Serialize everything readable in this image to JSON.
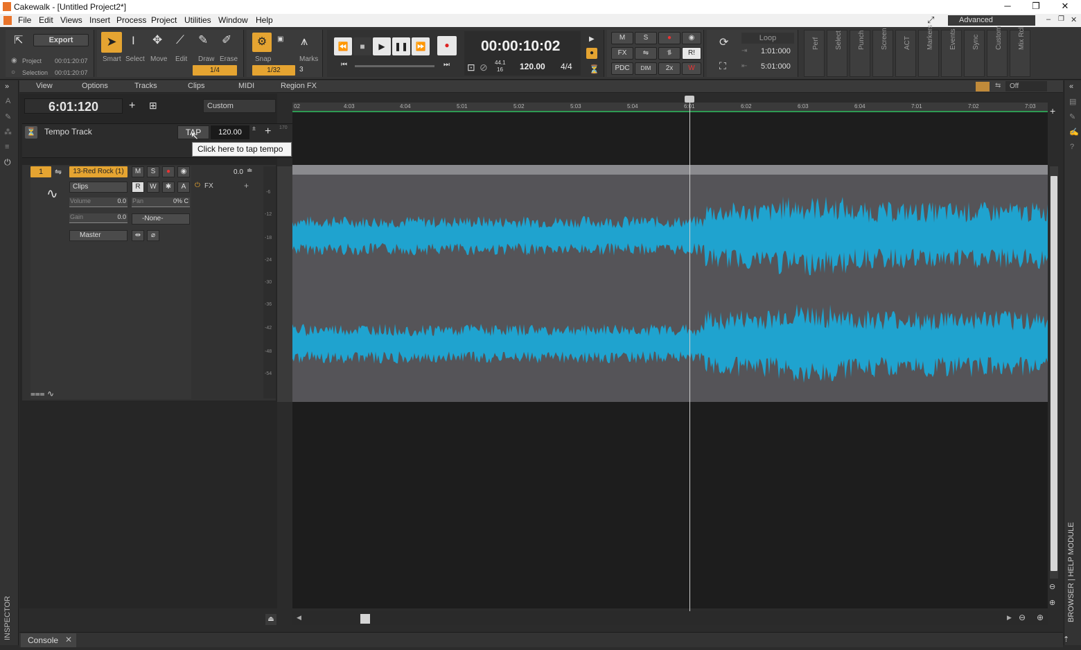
{
  "window": {
    "title": "Cakewalk - [Untitled Project2*]",
    "minimize": "─",
    "restore": "❐",
    "close": "✕"
  },
  "menu": {
    "items": [
      "File",
      "Edit",
      "Views",
      "Insert",
      "Process",
      "Project",
      "Utilities",
      "Window",
      "Help"
    ],
    "workspace": "Advanced"
  },
  "controlbar": {
    "export_label": "Export",
    "project_label": "Project",
    "project_time": "00:01:20:07",
    "selection_label": "Selection",
    "selection_time": "00:01:20:07",
    "tools": [
      "Smart",
      "Select",
      "Move",
      "Edit",
      "Draw",
      "Erase"
    ],
    "tool_size": "1/4",
    "snap_label": "Snap",
    "marks_label": "Marks",
    "snap_value": "1/32",
    "snap_count": "3",
    "time": "00:00:10:02",
    "sample_rate_top": "44.1",
    "sample_rate_bottom": "16",
    "tempo": "120.00",
    "meter": "4/4",
    "mix_m": "M",
    "mix_s": "S",
    "mix_fx": "FX",
    "mix_pdc": "PDC",
    "mix_dim": "DIM",
    "mix_2x": "2x",
    "mix_ri": "R!",
    "loop_label": "Loop",
    "loop_start": "1:01:000",
    "loop_end": "5:01:000",
    "vtabs": [
      "Perf",
      "Select",
      "Punch",
      "Screen",
      "ACT",
      "Markers",
      "Events",
      "Sync",
      "Custom",
      "Mix Rcl"
    ]
  },
  "trackview": {
    "menus": [
      "View",
      "Options",
      "Tracks",
      "Clips",
      "MIDI",
      "Region FX"
    ],
    "now_time": "6:01:120",
    "preset": "Custom",
    "snap_off": "Off",
    "ruler_ticks": [
      "02",
      "4:03",
      "4:04",
      "5:01",
      "5:02",
      "5:03",
      "5:04",
      "6:01",
      "6:02",
      "6:03",
      "6:04",
      "7:01",
      "7:02",
      "7:03"
    ]
  },
  "tempo_track": {
    "name": "Tempo Track",
    "tap": "TAP",
    "value": "120.00",
    "tooltip": "Click here to tap tempo",
    "scale_top": "170"
  },
  "track": {
    "number": "1",
    "name": "13-Red Rock (1)",
    "m": "M",
    "s": "S",
    "level": "0.0",
    "mode": "Clips",
    "r": "R",
    "w": "W",
    "a": "A",
    "fx": "FX",
    "volume_label": "Volume",
    "volume_value": "0.0",
    "pan_label": "Pan",
    "pan_value": "0% C",
    "gain_label": "Gain",
    "gain_value": "0.0",
    "input": "-None-",
    "output": "Master",
    "meter_scale": [
      "-6",
      "-12",
      "-18",
      "-24",
      "-30",
      "-36",
      "-42",
      "-48",
      "-54"
    ]
  },
  "bottom": {
    "console_tab": "Console",
    "inspector": "INSPECTOR",
    "browser": "BROWSER | HELP MODULE"
  },
  "colors": {
    "waveform": "#1fa3cf",
    "waveform_bg": "#1c8bb4",
    "clip": "#555458",
    "orange": "#e5a431"
  }
}
